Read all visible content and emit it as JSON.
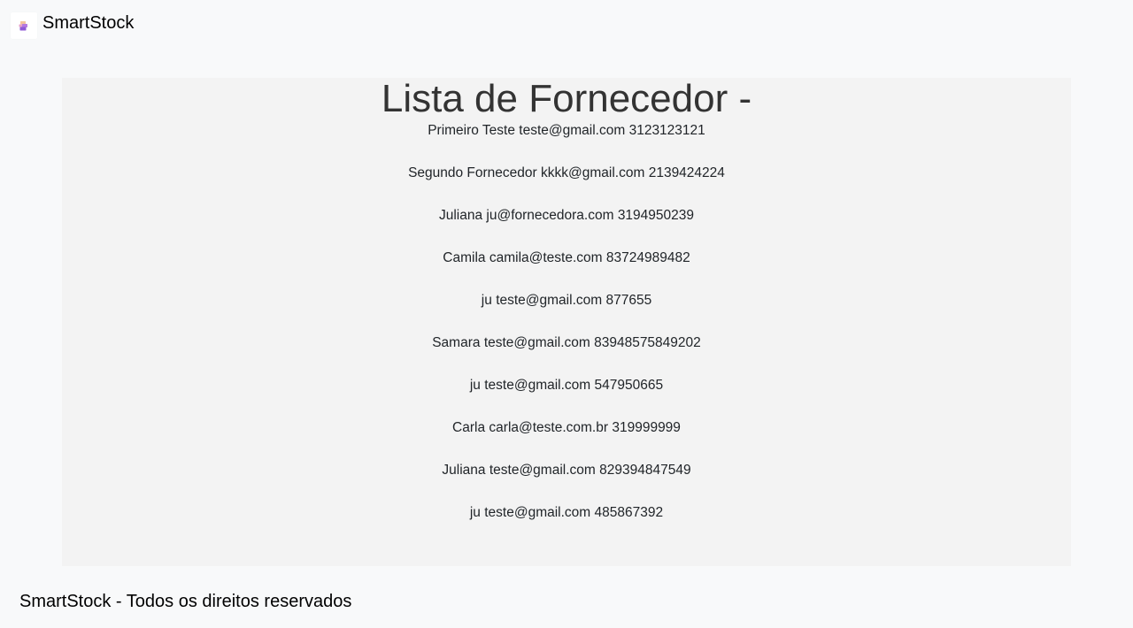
{
  "header": {
    "brand": "SmartStock",
    "logo_icon": "boxes-logo-icon"
  },
  "main": {
    "title": "Lista de Fornecedor -",
    "suppliers": [
      {
        "name": "Primeiro Teste",
        "email": "teste@gmail.com",
        "phone": "3123123121"
      },
      {
        "name": "Segundo Fornecedor",
        "email": "kkkk@gmail.com",
        "phone": "2139424224"
      },
      {
        "name": "Juliana",
        "email": "ju@fornecedora.com",
        "phone": "3194950239"
      },
      {
        "name": "Camila",
        "email": "camila@teste.com",
        "phone": "83724989482"
      },
      {
        "name": "ju",
        "email": "teste@gmail.com",
        "phone": "877655"
      },
      {
        "name": "Samara",
        "email": "teste@gmail.com",
        "phone": "83948575849202"
      },
      {
        "name": "ju",
        "email": "teste@gmail.com",
        "phone": "547950665"
      },
      {
        "name": "Carla",
        "email": "carla@teste.com.br",
        "phone": "319999999"
      },
      {
        "name": "Juliana",
        "email": "teste@gmail.com",
        "phone": "829394847549"
      },
      {
        "name": "ju",
        "email": "teste@gmail.com",
        "phone": "485867392"
      }
    ]
  },
  "footer": {
    "text": "SmartStock - Todos os direitos reservados"
  },
  "colors": {
    "page_background": "#f8f9fa",
    "card_background": "#f3f3f3",
    "title_text": "#333333",
    "list_text": "#212529"
  }
}
